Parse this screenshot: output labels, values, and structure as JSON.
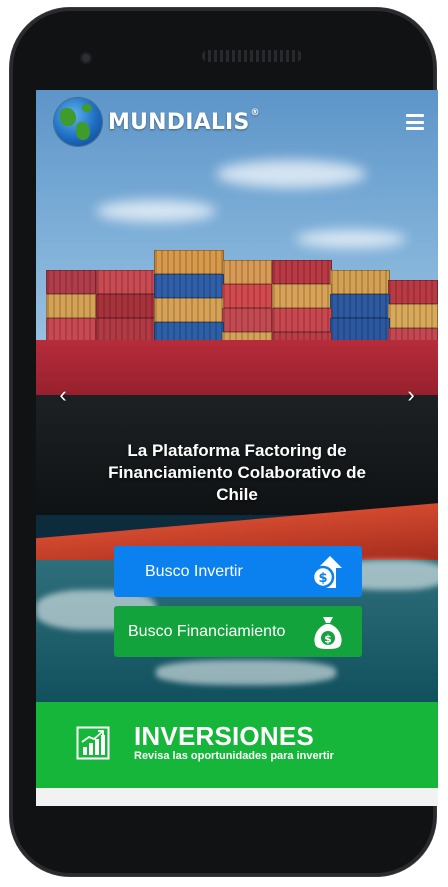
{
  "header": {
    "brand": "MUNDIALIS",
    "brand_mark": "®",
    "logo_icon": "globe-icon",
    "menu_icon": "hamburger-menu-icon"
  },
  "carousel": {
    "prev_icon": "chevron-left-icon",
    "next_icon": "chevron-right-icon",
    "prev_glyph": "‹",
    "next_glyph": "›"
  },
  "hero": {
    "headline": "La Plataforma Factoring de Financiamiento Colaborativo de Chile"
  },
  "actions": {
    "invest_label": "Busco Invertir",
    "invest_icon": "money-up-arrow-icon",
    "finance_label": "Busco Financiamiento",
    "finance_icon": "money-bag-icon"
  },
  "banner": {
    "title": "INVERSIONES",
    "subtitle": "Revisa las oportunidades para invertir",
    "icon": "bar-chart-icon"
  },
  "colors": {
    "invest_button": "#0b80ef",
    "finance_button": "#12a33c",
    "banner": "#16b63a",
    "phone": "#111214"
  }
}
